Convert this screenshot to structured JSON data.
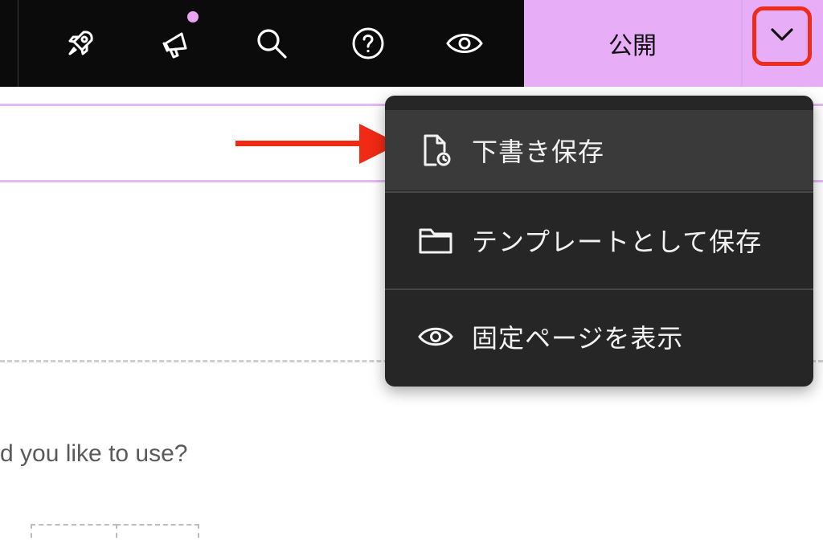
{
  "toolbar": {
    "icons": [
      "rocket-icon",
      "megaphone-icon",
      "search-icon",
      "help-icon",
      "eye-icon"
    ],
    "notification_color": "#e7a4f5",
    "publish_label": "公開",
    "publish_bg": "#e8adf7"
  },
  "menu": {
    "items": [
      {
        "label": "下書き保存",
        "icon": "draft-file-icon",
        "highlighted": true
      },
      {
        "label": "テンプレートとして保存",
        "icon": "folder-icon",
        "highlighted": false
      },
      {
        "label": "固定ページを表示",
        "icon": "eye-icon",
        "highlighted": false
      }
    ]
  },
  "content": {
    "question": "d you like to use?"
  },
  "annotation": {
    "arrow_color": "#f02a14",
    "highlight_border_color": "#ef2b1b"
  }
}
